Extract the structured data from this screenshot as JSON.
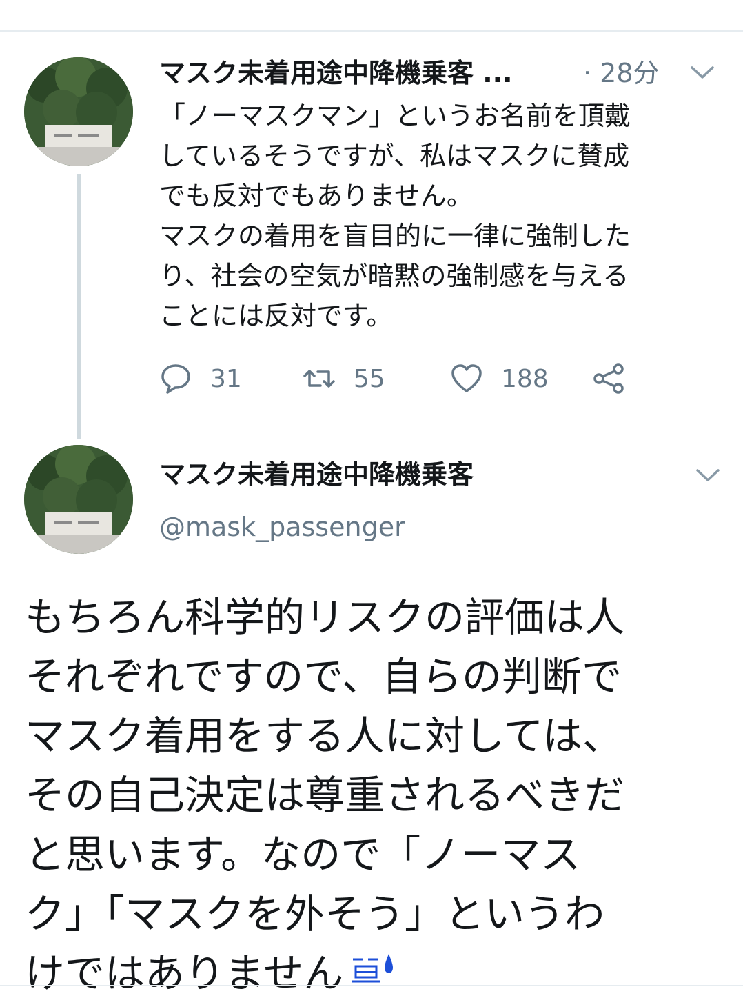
{
  "colors": {
    "text_primary": "#14171a",
    "text_secondary": "#657786",
    "divider": "#e6ecf0",
    "thread_line": "#cfd9de",
    "emoji_blue": "#1d4fd8"
  },
  "tweet1": {
    "display_name": "マスク未着用途中降機乗客 ...",
    "time": "· 28分",
    "text": "「ノーマスクマン」というお名前を頂戴\nしているそうですが、私はマスクに賛成\nでも反対でもありません。\nマスクの着用を盲目的に一律に強制した\nり、社会の空気が暗黙の強制感を与える\nことには反対です。",
    "replies": "31",
    "retweets": "55",
    "likes": "188",
    "icons": [
      "chat-bubble-icon",
      "retweet-icon",
      "heart-icon",
      "share-icon",
      "chevron-down-icon"
    ]
  },
  "tweet2": {
    "display_name": "マスク未着用途中降機乗客",
    "handle": "@mask_passenger",
    "text": "もちろん科学的リスクの評価は人\nそれぞれですので、自らの判断で\nマスク着用をする人に対しては、\nその自己決定は尊重されるべきだ\nと思います。なので「ノーマス\nク」「マスクを外そう」というわ\nけではありません",
    "emoji": "crying-face-emoji"
  }
}
